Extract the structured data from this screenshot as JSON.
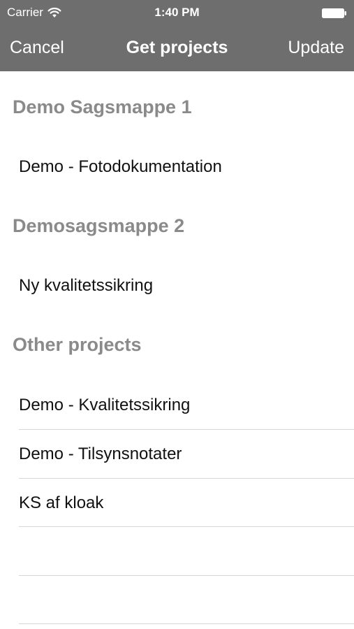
{
  "status_bar": {
    "carrier": "Carrier",
    "time": "1:40 PM"
  },
  "nav": {
    "cancel_label": "Cancel",
    "title": "Get projects",
    "update_label": "Update"
  },
  "sections": [
    {
      "header": "Demo Sagsmappe 1",
      "items": [
        "Demo - Fotodokumentation"
      ]
    },
    {
      "header": "Demosagsmappe 2",
      "items": [
        "Ny kvalitetssikring"
      ]
    },
    {
      "header": "Other projects",
      "items": [
        "Demo - Kvalitetssikring",
        "Demo - Tilsynsnotater",
        "KS af kloak"
      ]
    }
  ],
  "colors": {
    "nav_background": "#6e6e6e",
    "section_header": "#8a8a8a",
    "separator": "#d6d6d6"
  }
}
